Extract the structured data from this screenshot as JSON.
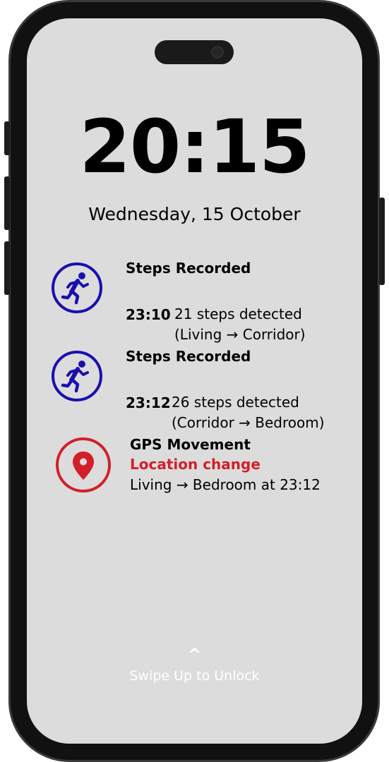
{
  "lockscreen": {
    "time": "20:15",
    "date": "Wednesday, 15 October"
  },
  "notifications": [
    {
      "icon": "running-person-icon",
      "title": "Steps Recorded",
      "time": "23:10",
      "line1": "21 steps detected",
      "line2": "(Living → Corridor)"
    },
    {
      "icon": "running-person-icon",
      "title": "Steps Recorded",
      "time": "23:12",
      "line1": "26 steps detected",
      "line2": "(Corridor → Bedroom)"
    },
    {
      "icon": "location-pin-icon",
      "title": "GPS Movement",
      "subtitle": "Location change",
      "line1": "Living → Bedroom at 23:12"
    }
  ],
  "unlock": {
    "caret": "^",
    "label": "Swipe Up  to Unlock"
  },
  "colors": {
    "screen_bg": "#dcdcdc",
    "steps_accent": "#1a0fb0",
    "gps_accent": "#d1202a",
    "frame": "#111111"
  }
}
